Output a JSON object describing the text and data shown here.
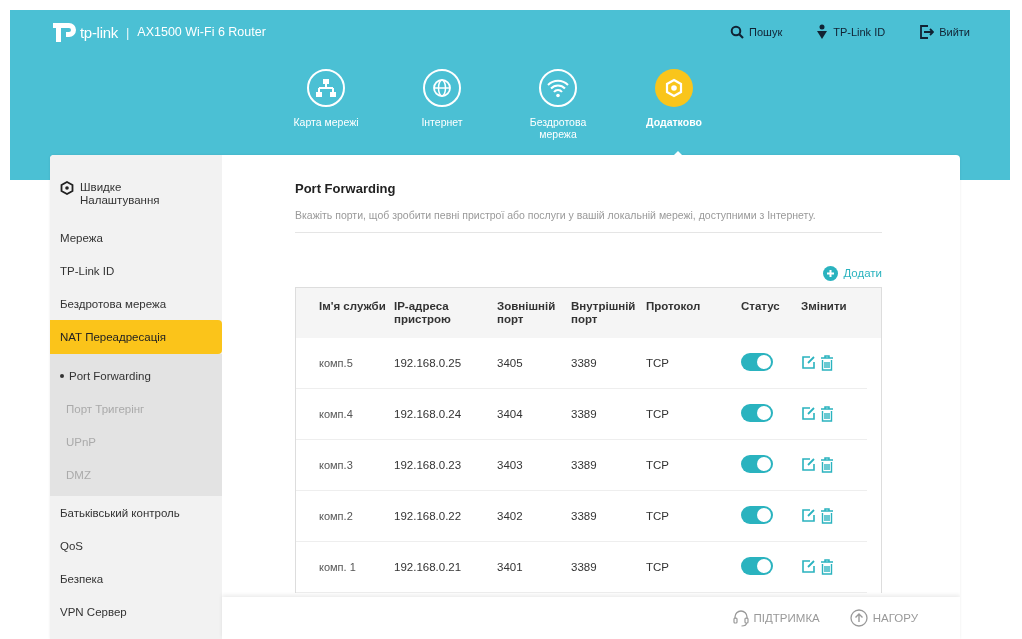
{
  "header": {
    "brand": "tp-link",
    "separator": "|",
    "model": "AX1500 Wi-Fi 6 Router",
    "top_links": [
      {
        "kind": "search",
        "label": "Пошук"
      },
      {
        "kind": "account",
        "label": "TP-Link ID"
      },
      {
        "kind": "logout",
        "label": "Вийти"
      }
    ]
  },
  "nav": [
    {
      "kind": "map",
      "label": "Карта мережі",
      "selected": false
    },
    {
      "kind": "globe",
      "label": "Інтернет",
      "selected": false
    },
    {
      "kind": "wifi",
      "label": "Бездротова мережа",
      "selected": false
    },
    {
      "kind": "gear",
      "label": "Додатково",
      "selected": true
    }
  ],
  "sidebar": {
    "items": [
      {
        "label": "Швидке Налаштування",
        "kind": "quick",
        "selected": false
      },
      {
        "label": "Мережа",
        "selected": false
      },
      {
        "label": "TP-Link ID",
        "selected": false
      },
      {
        "label": "Бездротова мережа",
        "selected": false
      },
      {
        "label": "NAT Переадресація",
        "selected": true,
        "children": [
          {
            "label": "Port Forwarding",
            "selected": true
          },
          {
            "label": "Порт Тригерінг",
            "selected": false
          },
          {
            "label": "UPnP",
            "selected": false
          },
          {
            "label": "DMZ",
            "selected": false
          }
        ]
      },
      {
        "label": "Батьківський контроль",
        "selected": false
      },
      {
        "label": "QoS",
        "selected": false
      },
      {
        "label": "Безпека",
        "selected": false
      },
      {
        "label": "VPN Сервер",
        "selected": false
      }
    ]
  },
  "main": {
    "title": "Port Forwarding",
    "description": "Вкажіть порти, щоб зробити певні пристрої або послуги у вашій локальній мережі, доступними з Інтернету.",
    "add_button": "Додати",
    "table": {
      "columns": [
        "Ім'я служби",
        "IP-адреса пристрою",
        "Зовнішній порт",
        "Внутрішній порт",
        "Протокол",
        "Статус",
        "Змінити"
      ],
      "rows": [
        {
          "cells": [
            "комп.5",
            "192.168.0.25",
            "3405",
            "3389",
            "TCP"
          ],
          "on": true
        },
        {
          "cells": [
            "комп.4",
            "192.168.0.24",
            "3404",
            "3389",
            "TCP"
          ],
          "on": true
        },
        {
          "cells": [
            "комп.3",
            "192.168.0.23",
            "3403",
            "3389",
            "TCP"
          ],
          "on": true
        },
        {
          "cells": [
            "комп.2",
            "192.168.0.22",
            "3402",
            "3389",
            "TCP"
          ],
          "on": true
        },
        {
          "cells": [
            "комп. 1",
            "192.168.0.21",
            "3401",
            "3389",
            "TCP"
          ],
          "on": true
        }
      ]
    }
  },
  "footer": {
    "links": [
      {
        "kind": "support",
        "label": "ПІДТРИМКА"
      },
      {
        "kind": "top",
        "label": "НАГОРУ"
      }
    ]
  }
}
